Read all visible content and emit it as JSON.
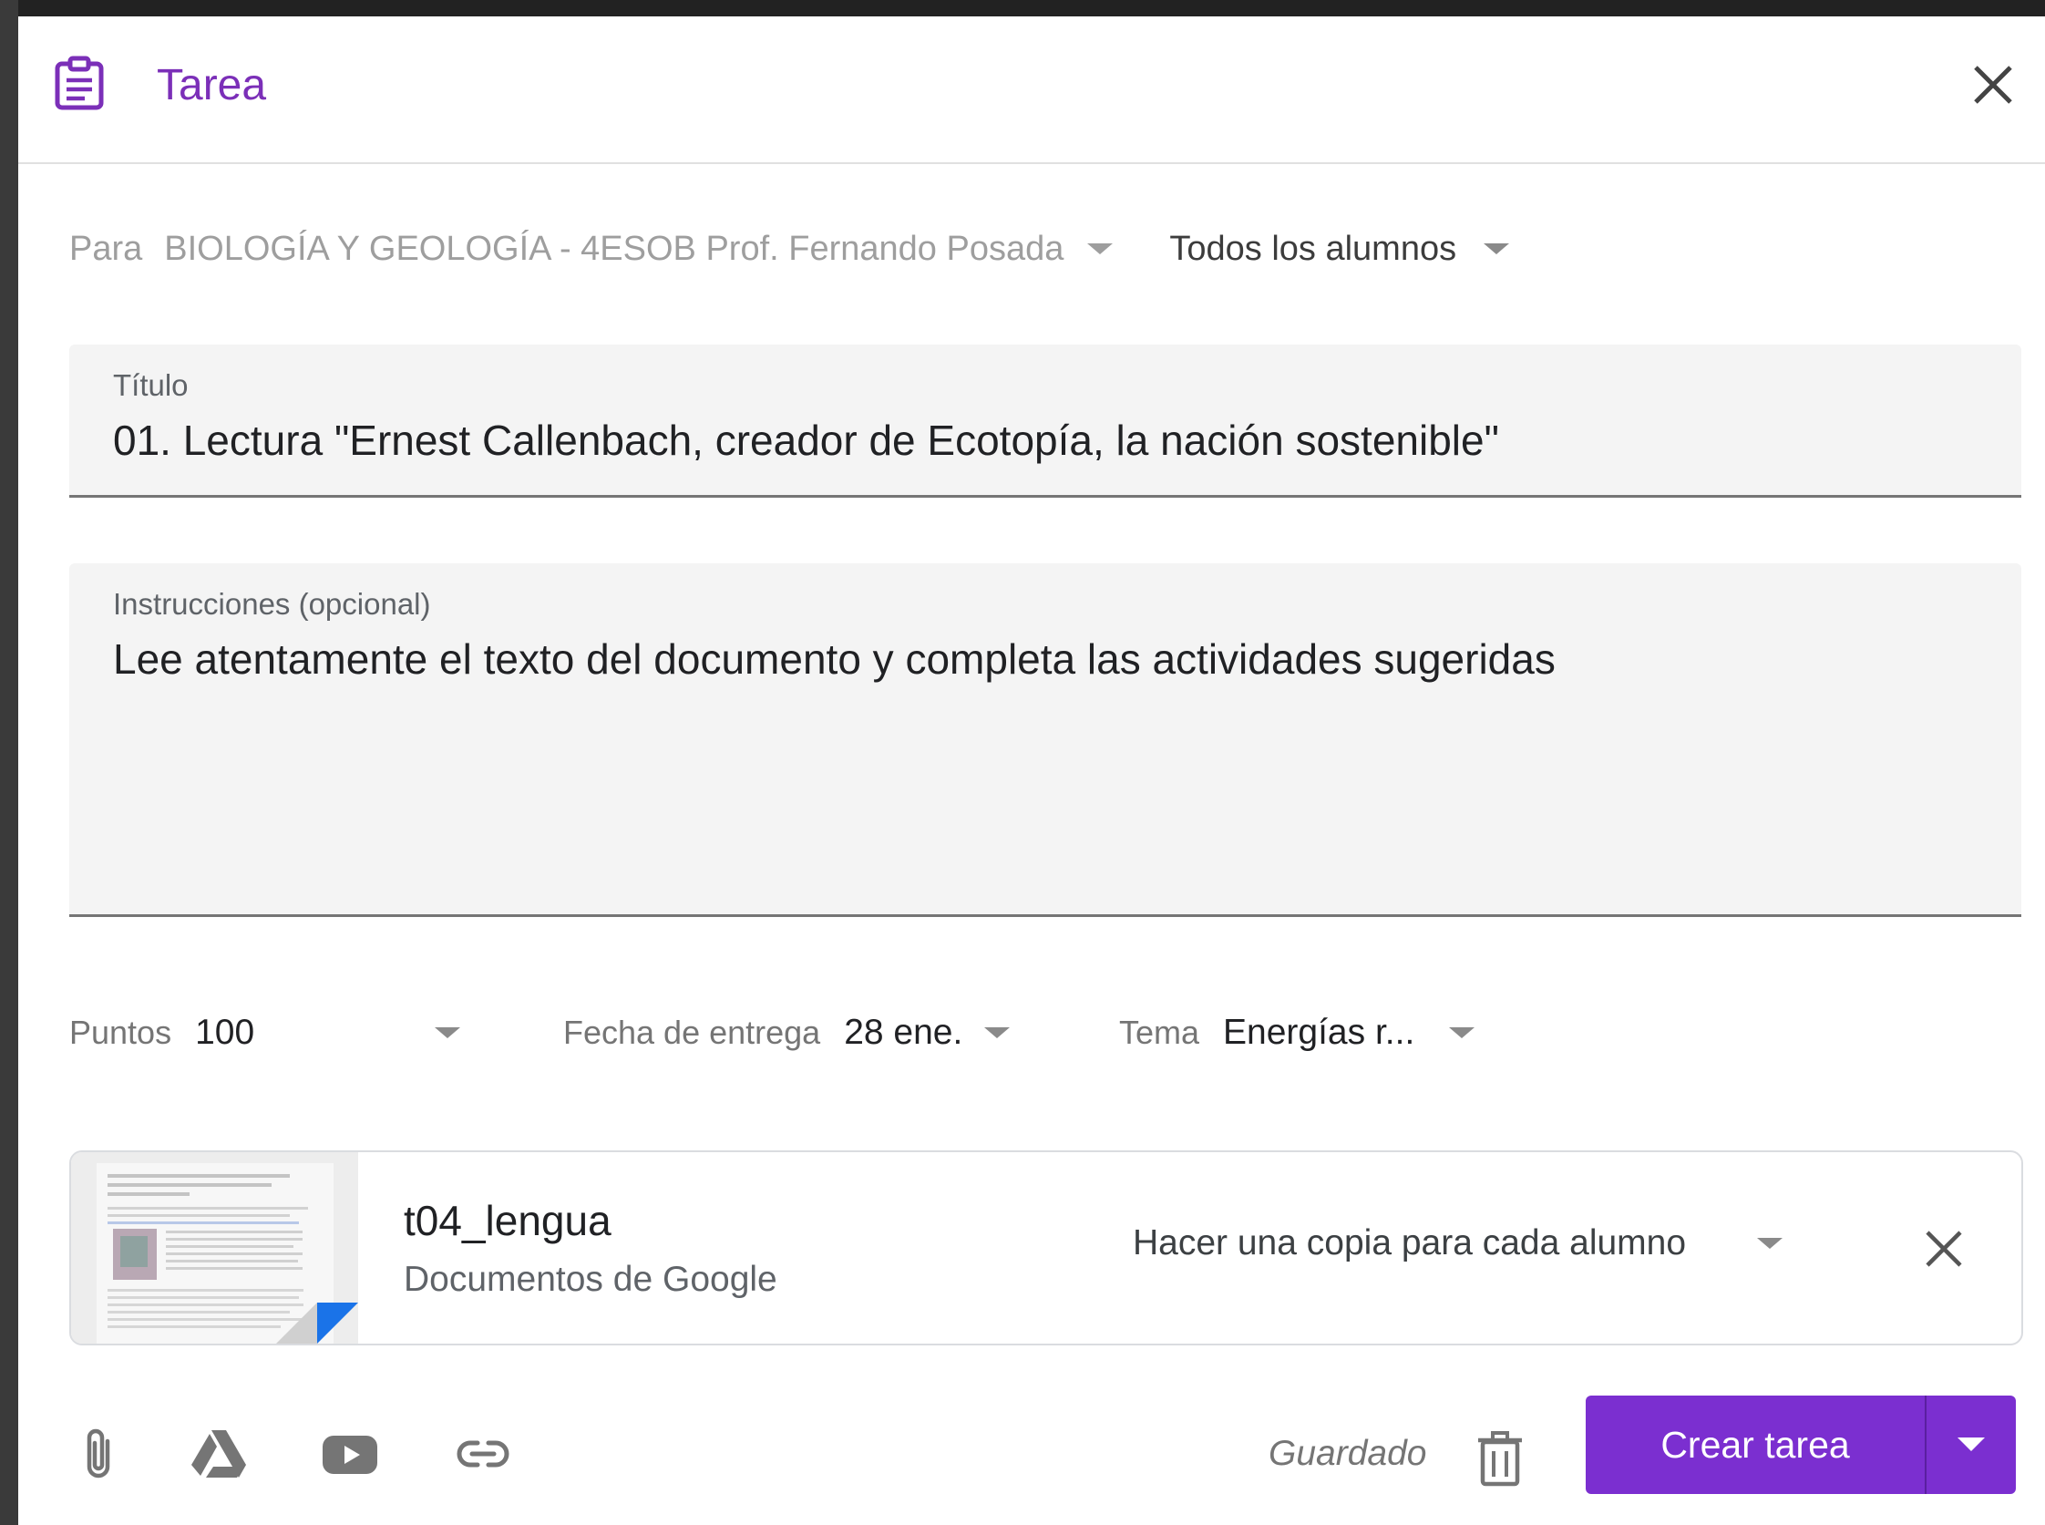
{
  "header": {
    "title": "Tarea",
    "icon": "assignment-icon",
    "accent_color": "#7b2fb8"
  },
  "audience": {
    "for_label": "Para",
    "class_value": "BIOLOGÍA Y GEOLOGÍA - 4ESOB Prof. Fernando Posada",
    "students_value": "Todos los alumnos"
  },
  "title_field": {
    "label": "Título",
    "value": "01. Lectura \"Ernest Callenbach, creador de Ecotopía, la nación sostenible\""
  },
  "instructions_field": {
    "label": "Instrucciones (opcional)",
    "value": "Lee atentamente el texto del documento y completa las actividades sugeridas"
  },
  "meta": {
    "points_label": "Puntos",
    "points_value": "100",
    "due_label": "Fecha de entrega",
    "due_value": "28 ene.",
    "topic_label": "Tema",
    "topic_value": "Energías r..."
  },
  "attachment": {
    "name": "t04_lengua",
    "type": "Documentos de Google",
    "mode": "Hacer una copia para cada alumno"
  },
  "toolbar": {
    "icons": [
      "paperclip-icon",
      "google-drive-icon",
      "youtube-icon",
      "link-icon"
    ],
    "status": "Guardado",
    "create_label": "Crear tarea",
    "button_color": "#7b2fd0"
  }
}
